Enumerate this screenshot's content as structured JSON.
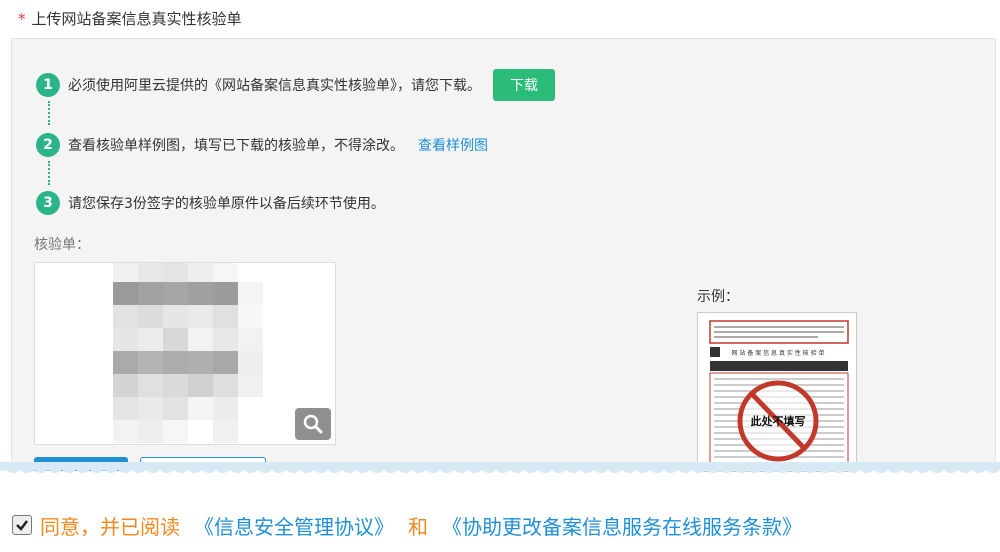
{
  "section": {
    "required_mark": "*",
    "title": "上传网站备案信息真实性核验单"
  },
  "steps": [
    {
      "number": "1",
      "text": "必须使用阿里云提供的《网站备案信息真实性核验单》，请您下载。",
      "button": "下载"
    },
    {
      "number": "2",
      "text": "查看核验单样例图，填写已下载的核验单，不得涂改。",
      "link": "查看样例图"
    },
    {
      "number": "3",
      "text": "请您保存3份签字的核验单原件以备后续环节使用。"
    }
  ],
  "upload": {
    "label": "核验单："
  },
  "example": {
    "label": "示例：",
    "header_text": "网 站 备 案 信 息 真 实 性 核 验 单",
    "stamp_text": "此处不填写"
  },
  "agreement": {
    "checked": true,
    "prefix": "同意，并已阅读",
    "doc1": "《信息安全管理协议》",
    "conj": "和",
    "doc2": "《协助更改备案信息服务在线服务条款》"
  },
  "colors": {
    "accent_green": "#2bb38a",
    "download_green": "#2bbc7a",
    "link_blue": "#1f8fd6",
    "required_red": "#e4393c",
    "agree_orange": "#f08a1f"
  },
  "icons": {
    "zoom": "magnifier-icon",
    "checkbox": "checkmark-icon"
  }
}
